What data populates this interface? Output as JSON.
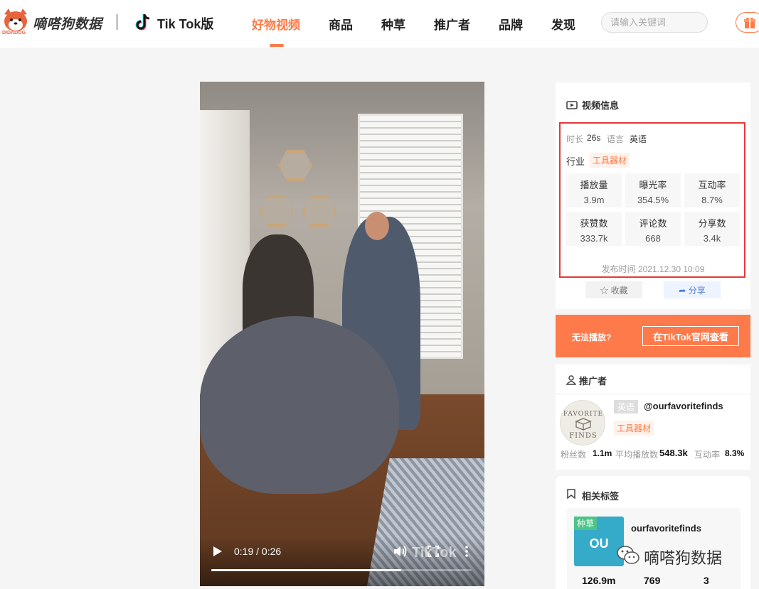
{
  "brand": {
    "name": "嘀嗒狗数据",
    "sub": "DIDADOG",
    "product": "Tik Tok版"
  },
  "nav": [
    {
      "label": "好物视频",
      "active": true
    },
    {
      "label": "商品",
      "active": false
    },
    {
      "label": "种草",
      "active": false
    },
    {
      "label": "推广者",
      "active": false
    },
    {
      "label": "品牌",
      "active": false
    },
    {
      "label": "发现",
      "active": false
    }
  ],
  "search": {
    "placeholder": "请输入关键词"
  },
  "video": {
    "time_display": "0:19 / 0:26",
    "progress": 0.73,
    "watermark": "TikTok",
    "icons": [
      "play-icon",
      "volume-icon",
      "fullscreen-icon",
      "more-icon"
    ]
  },
  "video_info": {
    "title": "视频信息",
    "duration_label": "时长",
    "duration": "26s",
    "language_label": "语言",
    "language": "英语",
    "industry_label": "行业",
    "industry": "工具器材",
    "stats": [
      {
        "label": "播放量",
        "value": "3.9m"
      },
      {
        "label": "曝光率",
        "value": "354.5%"
      },
      {
        "label": "互动率",
        "value": "8.7%"
      },
      {
        "label": "获赞数",
        "value": "333.7k"
      },
      {
        "label": "评论数",
        "value": "668"
      },
      {
        "label": "分享数",
        "value": "3.4k"
      }
    ],
    "published": "发布时间 2021.12.30 10:09",
    "favorite_label": "收藏",
    "share_label": "分享"
  },
  "cannot_play": {
    "question": "无法播放?",
    "button": "在TikTok官网查看"
  },
  "promoter": {
    "title": "推广者",
    "language": "英语",
    "handle": "@ourfavoritefinds",
    "industry": "工具器材",
    "avatar_top": "FAVORITE",
    "avatar_bottom": "FINDS",
    "fans_label": "粉丝数",
    "fans": "1.1m",
    "avg_play_label": "平均播放数",
    "avg_play": "548.3k",
    "engagement_label": "互动率",
    "engagement": "8.3%"
  },
  "related_tags": {
    "title": "相关标签",
    "badge": "种草",
    "thumb_text": "OU",
    "tag_name": "ourfavoritefinds",
    "numbers": [
      "126.9m",
      "769",
      "3"
    ]
  },
  "wechat_watermark": "嘀嗒狗数据",
  "colors": {
    "accent": "#ff7a45",
    "highlight_border": "#e53935",
    "tag_green": "#4cc38a"
  }
}
